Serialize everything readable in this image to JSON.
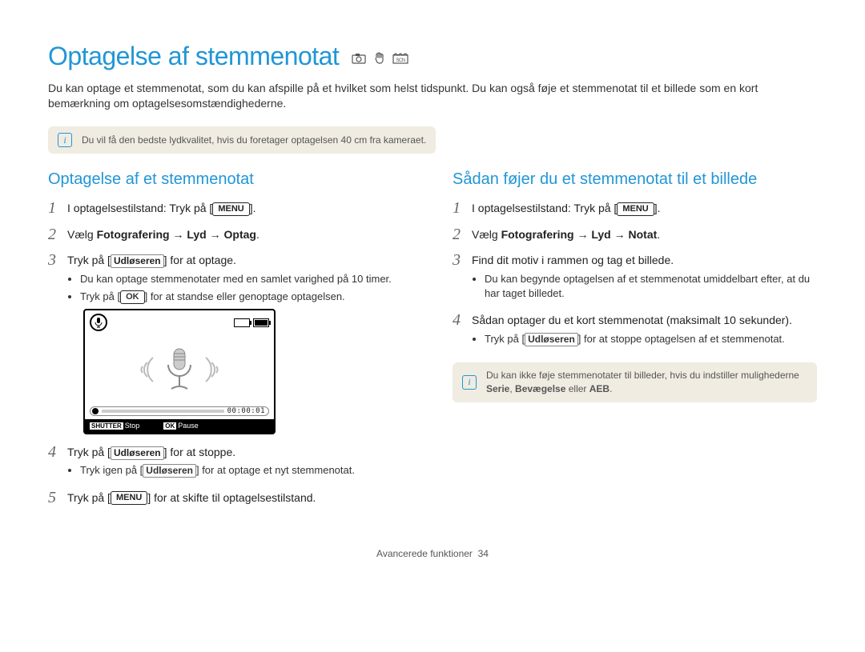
{
  "page": {
    "title": "Optagelse af stemmenotat",
    "intro": "Du kan optage et stemmenotat, som du kan afspille på et hvilket som helst tidspunkt. Du kan også føje et stemmenotat til et billede som en kort bemærkning om optagelsesomstændighederne.",
    "topNote": "Du vil få den bedste lydkvalitet, hvis du foretager optagelsen 40 cm fra kameraet.",
    "footerSection": "Avancerede funktioner",
    "footerPage": "34"
  },
  "keys": {
    "menu": "MENU",
    "ok": "OK",
    "shutter": "Udløseren"
  },
  "left": {
    "heading": "Optagelse af et stemmenotat",
    "step1_pre": "I optagelsestilstand: Tryk på [",
    "step1_post": "].",
    "step2_pre": "Vælg ",
    "step2_bold": "Fotografering → Lyd → Optag",
    "step2_post": ".",
    "step3_pre": "Tryk på [",
    "step3_post": "] for at optage.",
    "step3_bullet1": "Du kan optage stemmenotater med en samlet varighed på 10 timer.",
    "step3_bullet2_pre": "Tryk på [",
    "step3_bullet2_post": "] for at standse eller genoptage optagelsen.",
    "step4_pre": "Tryk på [",
    "step4_post": "] for at stoppe.",
    "step4_bullet_pre": "Tryk igen på [",
    "step4_bullet_post": "] for at optage et nyt stemmenotat.",
    "step5_pre": "Tryk på [",
    "step5_post": "] for at skifte til optagelsestilstand."
  },
  "right": {
    "heading": "Sådan føjer du et stemmenotat til et billede",
    "step1_pre": "I optagelsestilstand: Tryk på [",
    "step1_post": "].",
    "step2_pre": "Vælg ",
    "step2_bold": "Fotografering → Lyd → Notat",
    "step2_post": ".",
    "step3": "Find dit motiv i rammen og tag et billede.",
    "step3_bullet": "Du kan begynde optagelsen af et stemmenotat umiddelbart efter, at du har taget billedet.",
    "step4": "Sådan optager du et kort stemmenotat (maksimalt 10 sekunder).",
    "step4_bullet_pre": "Tryk på [",
    "step4_bullet_post": "] for at stoppe optagelsen af et stemmenotat.",
    "note_pre": "Du kan ikke føje stemmenotater til billeder, hvis du indstiller mulighederne ",
    "note_bold1": "Serie",
    "note_mid": ", ",
    "note_bold2": "Bevægelse",
    "note_mid2": " eller ",
    "note_bold3": "AEB",
    "note_post": "."
  },
  "screen": {
    "timecode": "00:00:01",
    "shutterLabel": "SHUTTER",
    "stop": "Stop",
    "okLabel": "OK",
    "pause": "Pause"
  }
}
